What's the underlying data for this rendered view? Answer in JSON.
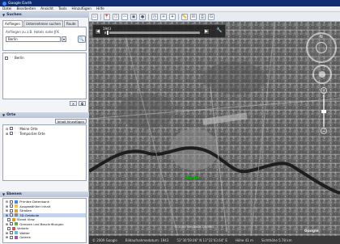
{
  "window": {
    "title": "Google Earth"
  },
  "menu": [
    "Datei",
    "Bearbeiten",
    "Ansicht",
    "Tools",
    "Hinzufügen",
    "Hilfe"
  ],
  "search": {
    "header": "Suchen",
    "tabs": [
      "Anfliegen",
      "Unternehmen suchen",
      "Route"
    ],
    "label": "Anfliegen zu z.B. Hotels nahe JFK",
    "input_value": "Berlin",
    "result": "Berlin"
  },
  "places": {
    "header": "Orte",
    "import_label": "Inhalt hinzufügen",
    "items": [
      "Meine Orte",
      "Temporäre Orte"
    ]
  },
  "layers": {
    "header": "Ebenen",
    "items": [
      "Primäre Datenbank",
      "Ausgewählter Inhalt",
      "Straßen",
      "3D-Gebäude",
      "Street View",
      "Grenzen und Beschriftungen",
      "Verkehr",
      "Wetter",
      "Galerie"
    ],
    "selected_index": 3
  },
  "timeslider": {
    "date": "1943"
  },
  "map": {
    "place_label": "Berlin",
    "copyright": "© 2009 GeoBasis-DE/BKG",
    "logo": "Google"
  },
  "status": {
    "items": [
      "© 2009 Google",
      "Bildaufnahmedatum: 1943",
      "52°30'59.06\" N 13°22'43.64\" E",
      "Höhe 41 m",
      "Sichthöhe 5.78 km"
    ]
  },
  "icons": [
    "search-icon",
    "wrench-icon",
    "play-icon",
    "compass-icon"
  ]
}
